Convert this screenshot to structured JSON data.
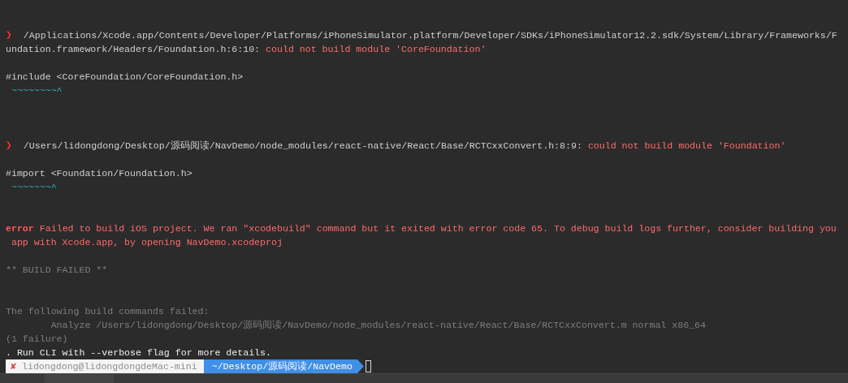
{
  "terminal": {
    "lines": [
      {
        "kind": "text",
        "segments": [
          {
            "kind": "marker",
            "text": "❯"
          },
          {
            "kind": "path",
            "text": "/Applications/Xcode.app/Contents/Developer/Platforms/iPhoneSimulator.platform/Developer/SDKs/iPhoneSimulator12.2.sdk/System/Library/Frameworks/F"
          }
        ]
      },
      {
        "kind": "text",
        "segments": [
          {
            "kind": "path",
            "text": "undation.framework/Headers/Foundation.h:6:10: "
          },
          {
            "kind": "error",
            "text": "could not build module 'CoreFoundation'"
          }
        ]
      },
      {
        "kind": "blank"
      },
      {
        "kind": "text",
        "segments": [
          {
            "kind": "path",
            "text": "#include <CoreFoundation/CoreFoundation.h>"
          }
        ]
      },
      {
        "kind": "text",
        "segments": [
          {
            "kind": "squiggle",
            "text": " ~~~~~~~~^"
          }
        ]
      },
      {
        "kind": "blank"
      },
      {
        "kind": "blank"
      },
      {
        "kind": "blank"
      },
      {
        "kind": "text",
        "segments": [
          {
            "kind": "marker",
            "text": "❯"
          },
          {
            "kind": "path",
            "text": "/Users/lidongdong/Desktop/源码阅读/NavDemo/node_modules/react-native/React/Base/RCTCxxConvert.h:8:9: "
          },
          {
            "kind": "error",
            "text": "could not build module 'Foundation'"
          }
        ]
      },
      {
        "kind": "blank"
      },
      {
        "kind": "text",
        "segments": [
          {
            "kind": "path",
            "text": "#import <Foundation/Foundation.h>"
          }
        ]
      },
      {
        "kind": "text",
        "segments": [
          {
            "kind": "squiggle",
            "text": " ~~~~~~~^"
          }
        ]
      },
      {
        "kind": "blank"
      },
      {
        "kind": "blank"
      },
      {
        "kind": "text",
        "segments": [
          {
            "kind": "error-label",
            "text": "error"
          },
          {
            "kind": "error",
            "text": "Failed to build iOS project. We ran \"xcodebuild\" command but it exited with error code 65. To debug build logs further, consider building you"
          }
        ]
      },
      {
        "kind": "text",
        "segments": [
          {
            "kind": "error",
            "text": " app with Xcode.app, by opening NavDemo.xcodeproj"
          }
        ]
      },
      {
        "kind": "blank"
      },
      {
        "kind": "text",
        "segments": [
          {
            "kind": "dim",
            "text": "** BUILD FAILED **"
          }
        ]
      },
      {
        "kind": "blank"
      },
      {
        "kind": "blank"
      },
      {
        "kind": "text",
        "segments": [
          {
            "kind": "dim",
            "text": "The following build commands failed:"
          }
        ]
      },
      {
        "kind": "text",
        "segments": [
          {
            "kind": "dim",
            "text": "        Analyze /Users/lidongdong/Desktop/源码阅读/NavDemo/node_modules/react-native/React/Base/RCTCxxConvert.m normal x86_64"
          }
        ]
      },
      {
        "kind": "text",
        "segments": [
          {
            "kind": "dim",
            "text": "(1 failure)"
          }
        ]
      },
      {
        "kind": "text",
        "segments": [
          {
            "kind": "bright",
            "text": ". Run CLI with --verbose flag for more details."
          }
        ]
      }
    ],
    "prompt": {
      "status": "✘",
      "host": "lidongdong@lidongdongdeMac-mini",
      "path": "~/Desktop/源码阅读/NavDemo"
    }
  }
}
